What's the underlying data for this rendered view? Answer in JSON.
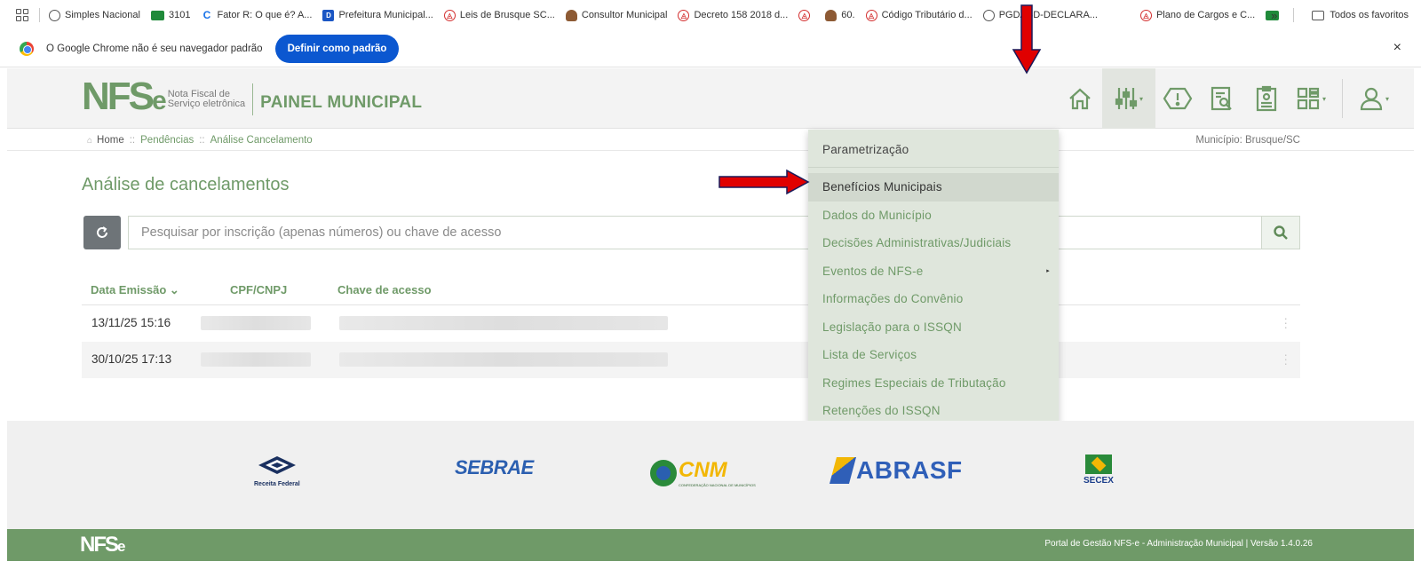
{
  "bookmarks": {
    "items": [
      {
        "label": "Simples Nacional",
        "icon": "globe-icon"
      },
      {
        "label": "3101",
        "icon": "brazil-flag-icon"
      },
      {
        "label": "Fator R: O que é? A...",
        "icon": "c-logo-icon"
      },
      {
        "label": "Prefeitura Municipal...",
        "icon": "d-logo-icon"
      },
      {
        "label": "Leis de Brusque SC...",
        "icon": "red-seal-icon"
      },
      {
        "label": "Consultor Municipal",
        "icon": "person-icon"
      },
      {
        "label": "Decreto 158 2018 d...",
        "icon": "red-seal-icon"
      },
      {
        "label": "60.",
        "icon": "person-icon"
      },
      {
        "label": "Código Tributário d...",
        "icon": "red-seal-icon"
      },
      {
        "label": "PGDASD-DECLARA...",
        "icon": "globe-icon"
      },
      {
        "label": "Plano de Cargos e C...",
        "icon": "red-seal-icon"
      }
    ],
    "overflow": "»",
    "all_favorites": "Todos os favoritos"
  },
  "infobar": {
    "message": "O Google Chrome não é seu navegador padrão",
    "button": "Definir como padrão",
    "close": "×"
  },
  "header": {
    "logo_text": "NFS",
    "logo_e": "e",
    "logo_sub_1": "Nota Fiscal de",
    "logo_sub_2": "Serviço eletrônica",
    "title": "PAINEL MUNICIPAL"
  },
  "breadcrumb": {
    "home": "Home",
    "pendencias": "Pendências",
    "current": "Análise Cancelamento",
    "sep": "::",
    "municipio": "Município: Brusque/SC"
  },
  "main": {
    "title": "Análise de cancelamentos",
    "search_placeholder": "Pesquisar por inscrição (apenas números) ou chave de acesso",
    "columns": {
      "data": "Data Emissão ⌄",
      "cpf": "CPF/CNPJ",
      "chave": "Chave de acesso"
    },
    "rows": [
      {
        "data": "13/11/25 15:16"
      },
      {
        "data": "30/10/25 17:13"
      }
    ]
  },
  "dropdown": {
    "items": [
      "Parametrização",
      "Benefícios Municipais",
      "Dados do Município",
      "Decisões Administrativas/Judiciais",
      "Eventos de NFS-e",
      "Informações do Convênio",
      "Legislação para o ISSQN",
      "Lista de Serviços",
      "Regimes Especiais de Tributação",
      "Retenções do ISSQN"
    ],
    "submenu_arrow": "▸"
  },
  "partners": {
    "receita": "Receita Federal",
    "sebrae": "SEBRAE",
    "cnm": "CNM",
    "cnm_sub": "CONFEDERAÇÃO NACIONAL DE MUNICÍPIOS",
    "abrasf": "ABRASF",
    "secex": "SECEX"
  },
  "footer": {
    "logo": "NFS",
    "logo_e": "e",
    "text": "Portal de Gestão NFS-e - Administração Municipal | Versão 1.4.0.26"
  },
  "colors": {
    "brand_green": "#6f9a68",
    "arrow_red": "#e00000",
    "chrome_blue": "#0b57d0"
  }
}
